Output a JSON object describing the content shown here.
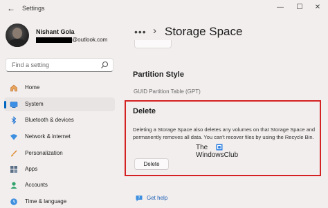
{
  "window": {
    "back_glyph": "←",
    "title": "Settings",
    "minimize_glyph": "—",
    "maximize_glyph": "☐",
    "close_glyph": "✕"
  },
  "profile": {
    "name": "Nishant Gola",
    "email_suffix": "@outlook.com"
  },
  "search": {
    "placeholder": "Find a setting",
    "icon": "search-icon"
  },
  "nav": {
    "items": [
      {
        "label": "Home",
        "icon": "home-icon"
      },
      {
        "label": "System",
        "icon": "system-icon",
        "selected": true
      },
      {
        "label": "Bluetooth & devices",
        "icon": "bluetooth-icon"
      },
      {
        "label": "Network & internet",
        "icon": "wifi-icon"
      },
      {
        "label": "Personalization",
        "icon": "brush-icon"
      },
      {
        "label": "Apps",
        "icon": "apps-icon"
      },
      {
        "label": "Accounts",
        "icon": "accounts-icon"
      },
      {
        "label": "Time & language",
        "icon": "clock-icon"
      }
    ]
  },
  "main": {
    "breadcrumb_more": "•••",
    "breadcrumb_chevron": "›",
    "title": "Storage Space",
    "partition_heading": "Partition Style",
    "partition_value": "GUID Partition Table (GPT)",
    "delete_heading": "Delete",
    "delete_description": "Deleting a Storage Space also deletes any volumes on that Storage Space and permanently removes all data. You can't recover files by using the Recycle Bin.",
    "delete_button": "Delete",
    "help_link": "Get help"
  },
  "watermark": {
    "line1": "The",
    "line2": "WindowsClub"
  },
  "colors": {
    "accent": "#0067c0",
    "highlight_border": "#d42121",
    "background": "#f3eeee"
  }
}
